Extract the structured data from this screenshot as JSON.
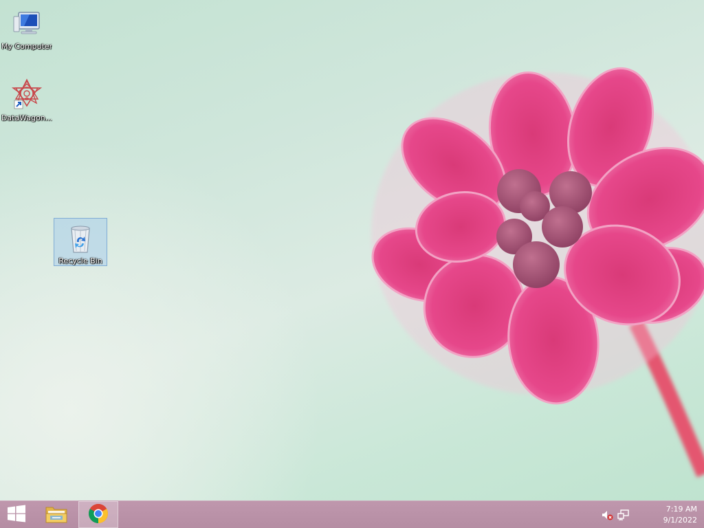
{
  "desktop": {
    "icons": [
      {
        "label": "My Computer",
        "icon": "computer-icon"
      },
      {
        "label": "DataWagon...",
        "icon": "datawagon-shortcut-icon"
      },
      {
        "label": "Recycle Bin",
        "icon": "recycle-bin-icon",
        "selected": true
      }
    ],
    "wallpaper": {
      "subject": "pink-flower-icon",
      "colors": {
        "petal": "#e0407e",
        "stem": "#e05a78",
        "background": "#c7e4d4"
      }
    }
  },
  "taskbar": {
    "start_icon": "windows-logo-icon",
    "pinned": [
      {
        "name": "File Explorer",
        "icon": "folder-icon"
      },
      {
        "name": "Google Chrome",
        "icon": "chrome-icon",
        "active": true
      }
    ],
    "tray": {
      "icons": [
        "speaker-muted-icon",
        "network-icon"
      ],
      "time": "7:19 AM",
      "date": "9/1/2022"
    },
    "color": "#b990a6"
  }
}
